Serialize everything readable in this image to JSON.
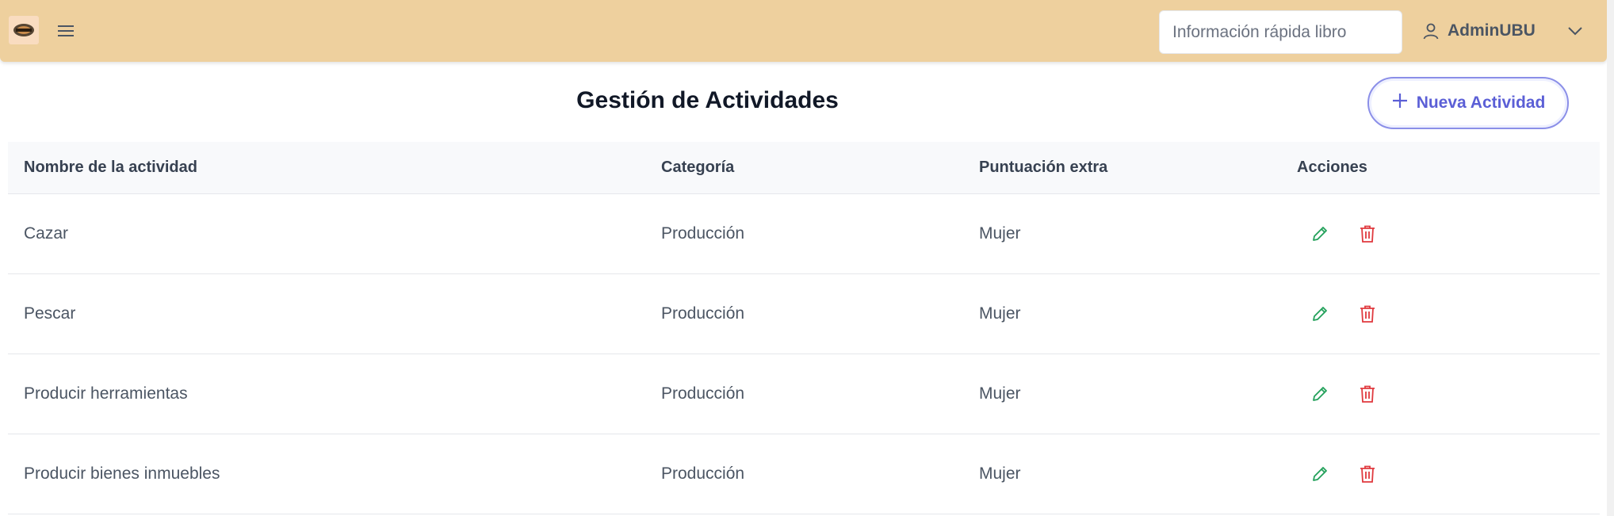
{
  "header": {
    "logo_icon": "logo-icon",
    "menu_icon": "hamburger-menu-icon",
    "search_placeholder": "Información rápida libro",
    "user_name": "AdminUBU",
    "user_icon": "user-icon",
    "chevron_icon": "chevron-down-icon",
    "bar_color": "#eed09e"
  },
  "page": {
    "title": "Gestión de Actividades",
    "new_button_label": "Nueva Actividad",
    "accent_color": "#5b5fd6"
  },
  "table": {
    "columns": [
      "Nombre de la actividad",
      "Categoría",
      "Puntuación extra",
      "Acciones"
    ],
    "rows": [
      {
        "name": "Cazar",
        "category": "Producción",
        "extra": "Mujer"
      },
      {
        "name": "Pescar",
        "category": "Producción",
        "extra": "Mujer"
      },
      {
        "name": "Producir herramientas",
        "category": "Producción",
        "extra": "Mujer"
      },
      {
        "name": "Producir bienes inmuebles",
        "category": "Producción",
        "extra": "Mujer"
      }
    ],
    "edit_icon": "pencil-icon",
    "delete_icon": "trash-icon",
    "edit_color": "#22a05a",
    "delete_color": "#e0393e"
  }
}
